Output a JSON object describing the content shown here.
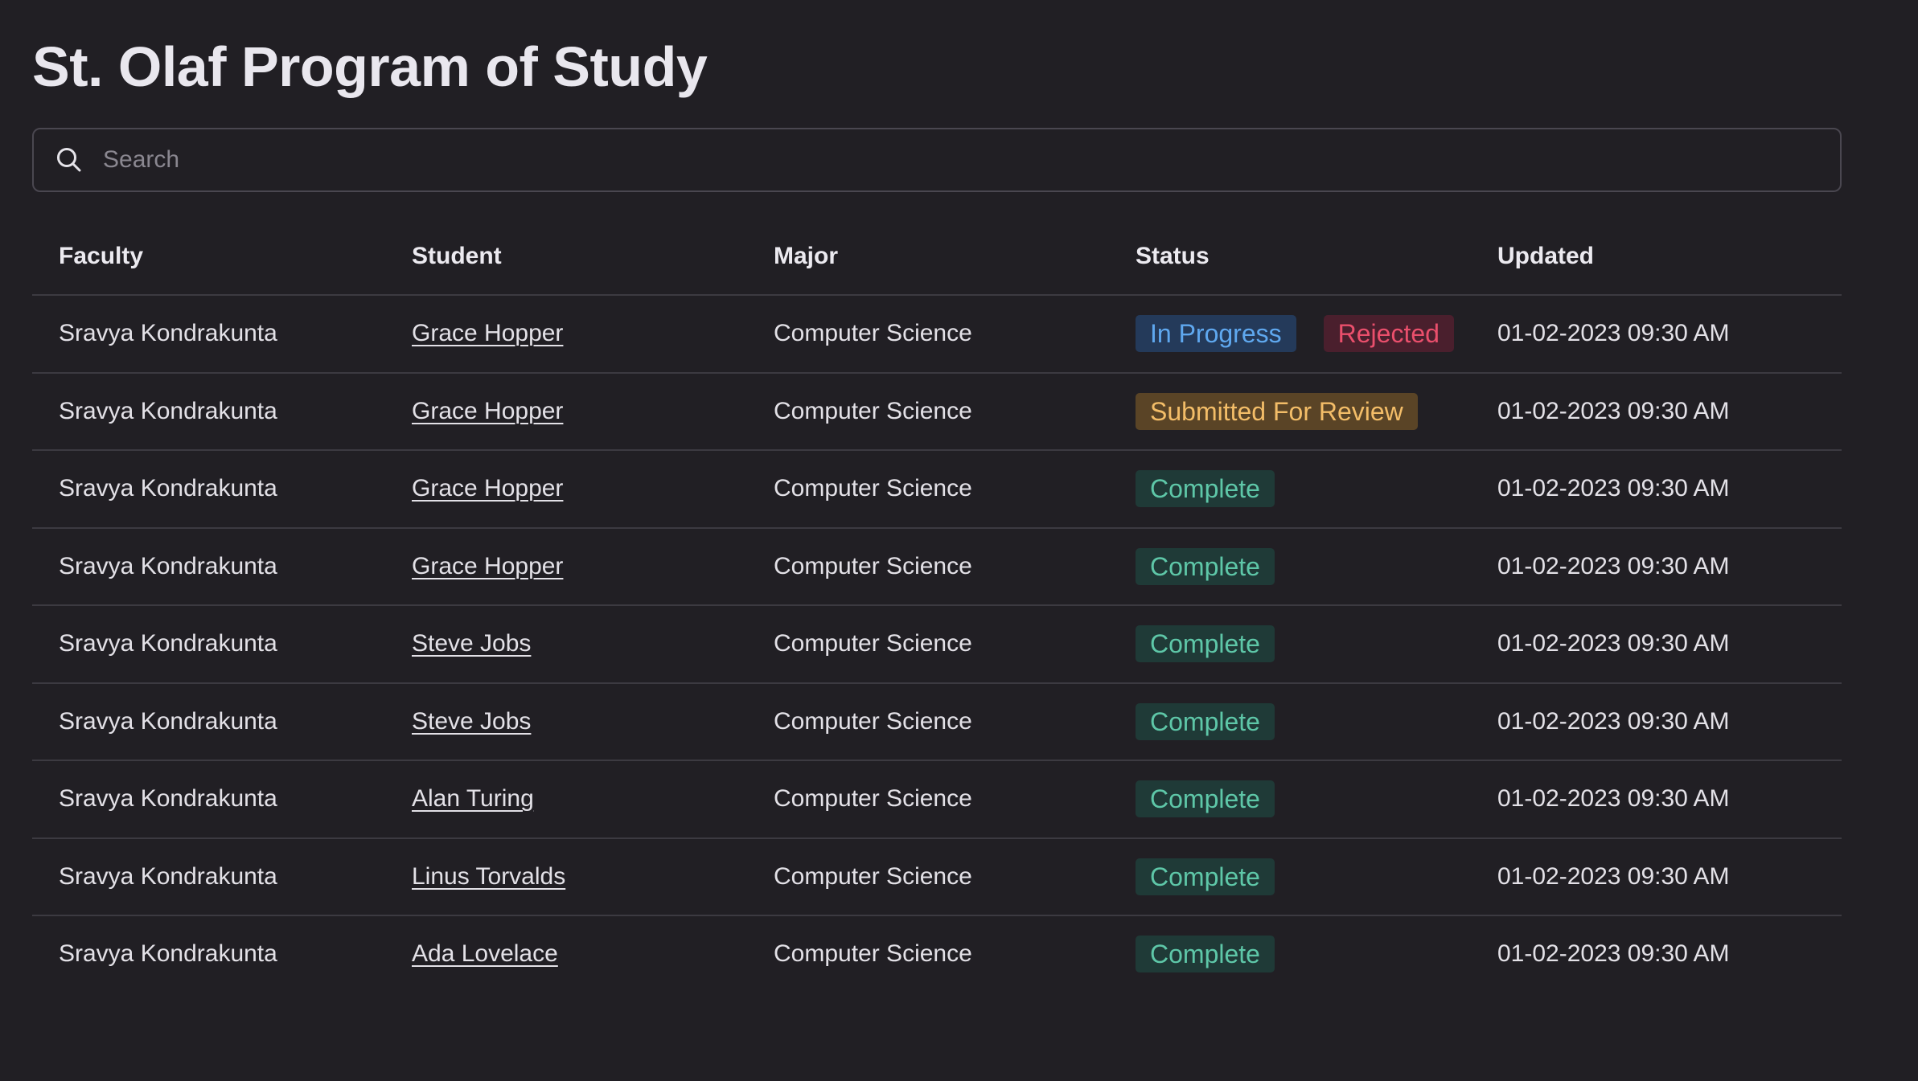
{
  "page": {
    "title": "St. Olaf Program of Study"
  },
  "search": {
    "placeholder": "Search",
    "value": "",
    "icon": "search-icon"
  },
  "table": {
    "headers": {
      "faculty": "Faculty",
      "student": "Student",
      "major": "Major",
      "status": "Status",
      "updated": "Updated"
    },
    "rows": [
      {
        "faculty": "Sravya Kondrakunta",
        "student": "Grace Hopper",
        "major": "Computer Science",
        "statuses": [
          "In Progress",
          "Rejected"
        ],
        "updated": "01-02-2023 09:30 AM"
      },
      {
        "faculty": "Sravya Kondrakunta",
        "student": "Grace Hopper",
        "major": "Computer Science",
        "statuses": [
          "Submitted For Review"
        ],
        "updated": "01-02-2023 09:30 AM"
      },
      {
        "faculty": "Sravya Kondrakunta",
        "student": "Grace Hopper",
        "major": "Computer Science",
        "statuses": [
          "Complete"
        ],
        "updated": "01-02-2023 09:30 AM"
      },
      {
        "faculty": "Sravya Kondrakunta",
        "student": "Grace Hopper",
        "major": "Computer Science",
        "statuses": [
          "Complete"
        ],
        "updated": "01-02-2023 09:30 AM"
      },
      {
        "faculty": "Sravya Kondrakunta",
        "student": "Steve Jobs",
        "major": "Computer Science",
        "statuses": [
          "Complete"
        ],
        "updated": "01-02-2023 09:30 AM"
      },
      {
        "faculty": "Sravya Kondrakunta",
        "student": "Steve Jobs",
        "major": "Computer Science",
        "statuses": [
          "Complete"
        ],
        "updated": "01-02-2023 09:30 AM"
      },
      {
        "faculty": "Sravya Kondrakunta",
        "student": "Alan Turing",
        "major": "Computer Science",
        "statuses": [
          "Complete"
        ],
        "updated": "01-02-2023 09:30 AM"
      },
      {
        "faculty": "Sravya Kondrakunta",
        "student": "Linus Torvalds",
        "major": "Computer Science",
        "statuses": [
          "Complete"
        ],
        "updated": "01-02-2023 09:30 AM"
      },
      {
        "faculty": "Sravya Kondrakunta",
        "student": "Ada Lovelace",
        "major": "Computer Science",
        "statuses": [
          "Complete"
        ],
        "updated": "01-02-2023 09:30 AM"
      }
    ]
  },
  "colors": {
    "background": "#211f24",
    "in_progress": "#5fa8ef",
    "rejected": "#ea4f6c",
    "submitted_for_review": "#f3bd68",
    "complete": "#5ec7a8"
  }
}
